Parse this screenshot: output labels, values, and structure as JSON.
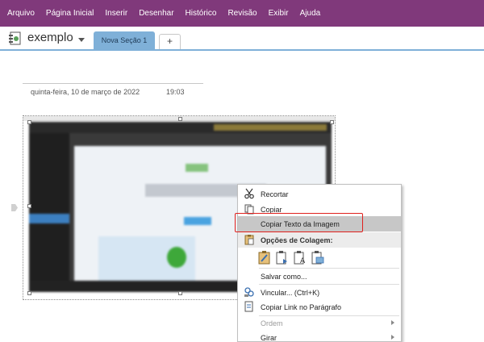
{
  "menu": {
    "items": [
      "Arquivo",
      "Página Inicial",
      "Inserir",
      "Desenhar",
      "Histórico",
      "Revisão",
      "Exibir",
      "Ajuda"
    ]
  },
  "notebook": {
    "name": "exemplo",
    "active_section": "Nova Seção 1",
    "add_section_label": "+"
  },
  "page": {
    "date": "quinta-feira, 10 de março de 2022",
    "time": "19:03"
  },
  "context_menu": {
    "cut": "Recortar",
    "copy": "Copiar",
    "copy_text_from_image": "Copiar Texto da Imagem",
    "paste_options_header": "Opções de Colagem:",
    "save_as": "Salvar como...",
    "link": "Vincular...  (Ctrl+K)",
    "copy_paragraph_link": "Copiar Link no Parágrafo",
    "order": "Ordem",
    "rotate": "Girar"
  },
  "colors": {
    "menubar_bg": "#80397b",
    "section_tab": "#7fb0d8",
    "highlight_box": "#e0201d"
  },
  "icons": {
    "notebook": "notebook-icon",
    "cut": "scissors-icon",
    "copy": "copy-icon",
    "paste": "clipboard-icon",
    "link": "link-icon",
    "paragraph_link": "paragraph-link-icon"
  }
}
